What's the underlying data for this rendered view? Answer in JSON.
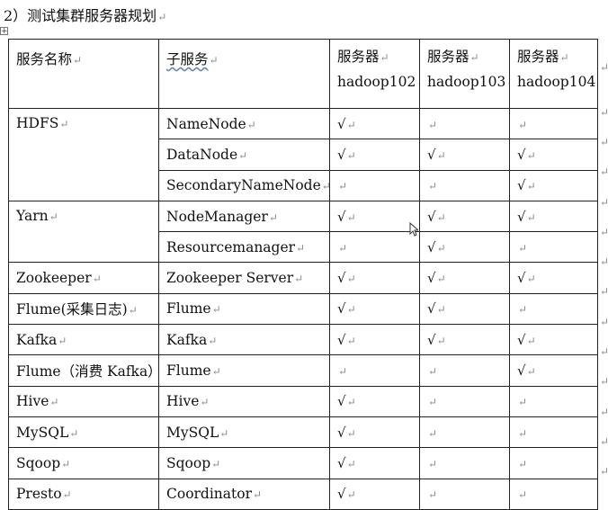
{
  "heading": "2）测试集群服务器规划",
  "para_mark": "↵",
  "table_handle": "+",
  "check": "√",
  "header": {
    "service_name": "服务名称",
    "sub_service": "子服务",
    "servers": [
      {
        "label": "服务器",
        "host": "hadoop102"
      },
      {
        "label": "服务器",
        "host": "hadoop103"
      },
      {
        "label": "服务器",
        "host": "hadoop104"
      }
    ]
  },
  "rows": [
    {
      "service": "HDFS",
      "sub": "NameNode",
      "h102": true,
      "h103": false,
      "h104": false
    },
    {
      "service": "",
      "sub": "DataNode",
      "h102": true,
      "h103": true,
      "h104": true
    },
    {
      "service": "",
      "sub": "SecondaryNameNode",
      "h102": false,
      "h103": false,
      "h104": true
    },
    {
      "service": "Yarn",
      "sub": "NodeManager",
      "h102": true,
      "h103": true,
      "h104": true
    },
    {
      "service": "",
      "sub": "Resourcemanager",
      "h102": false,
      "h103": true,
      "h104": false
    },
    {
      "service": "Zookeeper",
      "sub": "Zookeeper Server",
      "h102": true,
      "h103": true,
      "h104": true
    },
    {
      "service": "Flume(采集日志)",
      "sub": "Flume",
      "h102": true,
      "h103": true,
      "h104": false
    },
    {
      "service": "Kafka",
      "sub": "Kafka",
      "h102": true,
      "h103": true,
      "h104": true
    },
    {
      "service": "Flume（消费 Kafka）",
      "sub": "Flume",
      "h102": false,
      "h103": false,
      "h104": true
    },
    {
      "service": "Hive",
      "sub": "Hive",
      "h102": true,
      "h103": false,
      "h104": false
    },
    {
      "service": "MySQL",
      "sub": "MySQL",
      "h102": true,
      "h103": false,
      "h104": false
    },
    {
      "service": "Sqoop",
      "sub": "Sqoop",
      "h102": true,
      "h103": false,
      "h104": false
    },
    {
      "service": "Presto",
      "sub": "Coordinator",
      "h102": true,
      "h103": false,
      "h104": false
    }
  ]
}
